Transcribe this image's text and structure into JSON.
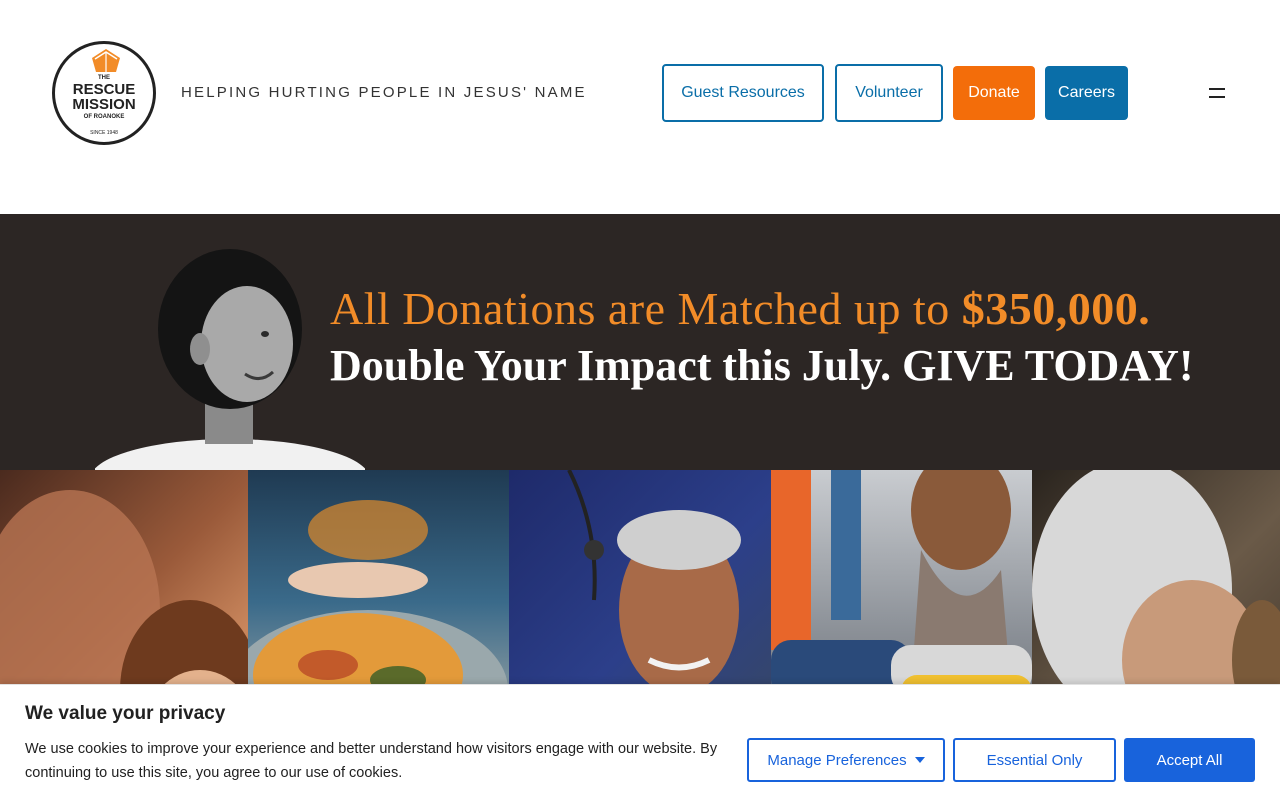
{
  "header": {
    "logo": {
      "the": "THE",
      "line1": "RESCUE",
      "line2": "MISSION",
      "line3": "OF ROANOKE",
      "since": "SINCE 1948"
    },
    "tagline": "HELPING HURTING PEOPLE IN JESUS' NAME",
    "nav": {
      "guest_resources": "Guest Resources",
      "volunteer": "Volunteer",
      "donate": "Donate",
      "careers": "Careers"
    },
    "colors": {
      "blue": "#0a6ea8",
      "orange": "#f36d0a"
    }
  },
  "banner": {
    "line1_prefix": "All Donations are Matched up to ",
    "line1_amount": "$350,000.",
    "line2": "Double Your Impact this July. GIVE TODAY!",
    "colors": {
      "background": "#2c2624",
      "accent": "#f28c28"
    }
  },
  "photos": [
    "mother-and-child",
    "food-plate",
    "elderly-man-with-nurse",
    "folded-clothes",
    "elderly-woman"
  ],
  "cookie": {
    "title": "We value your privacy",
    "text": "We use cookies to improve your experience and better understand how visitors engage with our website. By continuing to use this site, you agree to our use of cookies.",
    "manage": "Manage Preferences",
    "essential": "Essential Only",
    "accept": "Accept All",
    "color": "#1863dc"
  }
}
